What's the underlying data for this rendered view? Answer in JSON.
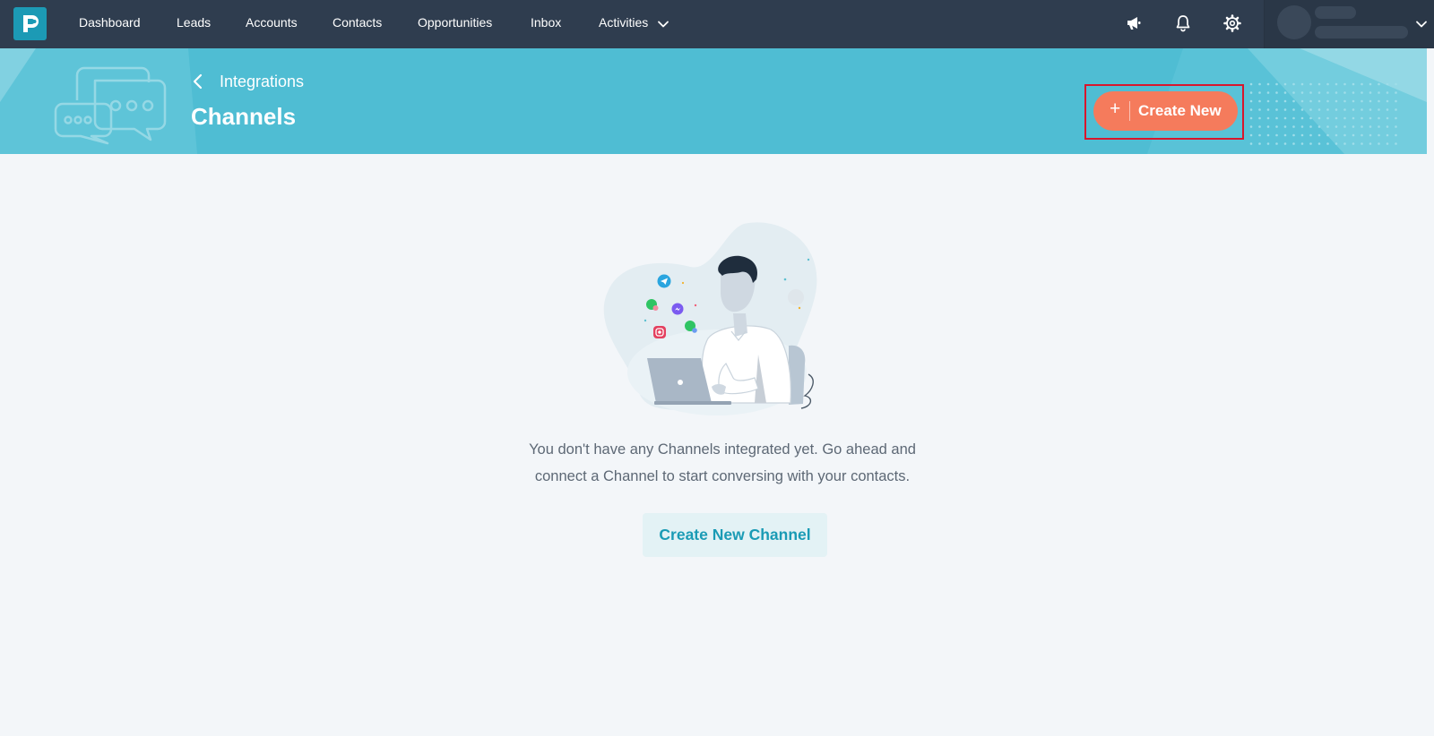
{
  "brand": {
    "logo_icon": "p-logo",
    "color": "#1c9ab5"
  },
  "nav": {
    "items": [
      {
        "label": "Dashboard"
      },
      {
        "label": "Leads"
      },
      {
        "label": "Accounts"
      },
      {
        "label": "Contacts"
      },
      {
        "label": "Opportunities"
      },
      {
        "label": "Inbox"
      },
      {
        "label": "Activities"
      }
    ],
    "icons": [
      "megaphone-icon",
      "bell-icon",
      "gear-icon"
    ]
  },
  "header": {
    "breadcrumb": "Integrations",
    "title": "Channels",
    "create_button": "Create New",
    "create_icon": "+"
  },
  "empty_state": {
    "message_line1": "You don't have any Channels integrated yet. Go ahead and",
    "message_line2": "connect a Channel to start conversing with your contacts.",
    "button_label": "Create New Channel"
  },
  "colors": {
    "topbar": "#2f3d4f",
    "banner": "#4fbdd3",
    "accent_button": "#f57b5c",
    "highlight": "#d8162c",
    "link_teal": "#1a9bb5"
  }
}
